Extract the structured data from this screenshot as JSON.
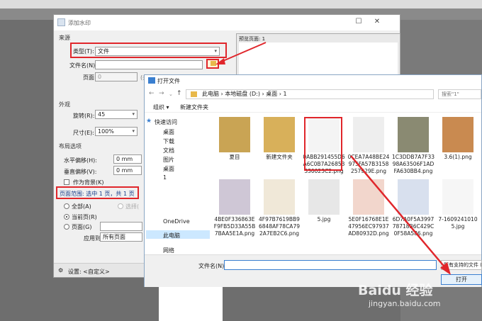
{
  "watermark_dialog": {
    "title": "添加水印",
    "section_source": "来源",
    "type_label": "类型(T):",
    "type_value": "文件",
    "filename_label": "文件名(N):",
    "page_label": "页面:",
    "page_value": "0",
    "page_suffix": "(共",
    "section_appearance": "外观",
    "rotation_label": "旋转(R):",
    "rotation_value": "45",
    "size_label": "尺寸(E):",
    "size_value": "100%",
    "section_layout": "布局选项",
    "hoffset_label": "水平偏移(H):",
    "hoffset_value": "0 mm",
    "voffset_label": "垂直偏移(V):",
    "voffset_value": "0 mm",
    "background_label": "作为背景(K)",
    "page_range_label": "页面范围: 选中 1 页，共 1 页",
    "all_label": "全部(A)",
    "selected_label": "选择(",
    "current_label": "当前页(R)",
    "pages_label": "页面(G)",
    "apply_label": "应用到:",
    "apply_value": "所有页面",
    "settings_label": "设置: <自定义>",
    "preview_label": "预览页面: 1"
  },
  "open_dialog": {
    "title": "打开文件",
    "breadcrumb": [
      "此电脑",
      "本地磁盘 (D:)",
      "桌面",
      "1"
    ],
    "search_placeholder": "搜索\"1\"",
    "toolbar": {
      "organize": "组织 ▾",
      "new_folder": "新建文件夹"
    },
    "sidebar": {
      "quick_access": "快速访问",
      "items": [
        "桌面",
        "下载",
        "文档",
        "图片",
        "桌面",
        "1"
      ],
      "onedrive": "OneDrive",
      "thispc": "此电脑",
      "network": "网络"
    },
    "files": [
      {
        "name": "夏目"
      },
      {
        "name": "新建文件夹"
      },
      {
        "name": "0ABB291455D6A6C0B7A26853330023C2.png"
      },
      {
        "name": "0CEA7A48BE24975FA57B3158257929E.png"
      },
      {
        "name": "1C3DDB7A7F3398A63506F1ADFA630BB4.png"
      },
      {
        "name": "3.6(1).png"
      },
      {
        "name": "4BE0F336863EF9FB5D33A55B7BAA5E1A.png"
      },
      {
        "name": "4F97B7619BB96848AF78CA792A7EB2C6.png"
      },
      {
        "name": "5.jpg"
      },
      {
        "name": "5E0F16768E1E47956EC97937AD80932D.png"
      },
      {
        "name": "6D7A0F5A399778718B6C429C0F58A586.png"
      },
      {
        "name": "7-16092410105.jpg"
      }
    ],
    "filename_label": "文件名(N):",
    "filetype": "所有支持的文件 (*",
    "open_button": "打开"
  },
  "watermark": {
    "brand": "Baidu 经验",
    "url": "jingyan.baidu.com"
  }
}
